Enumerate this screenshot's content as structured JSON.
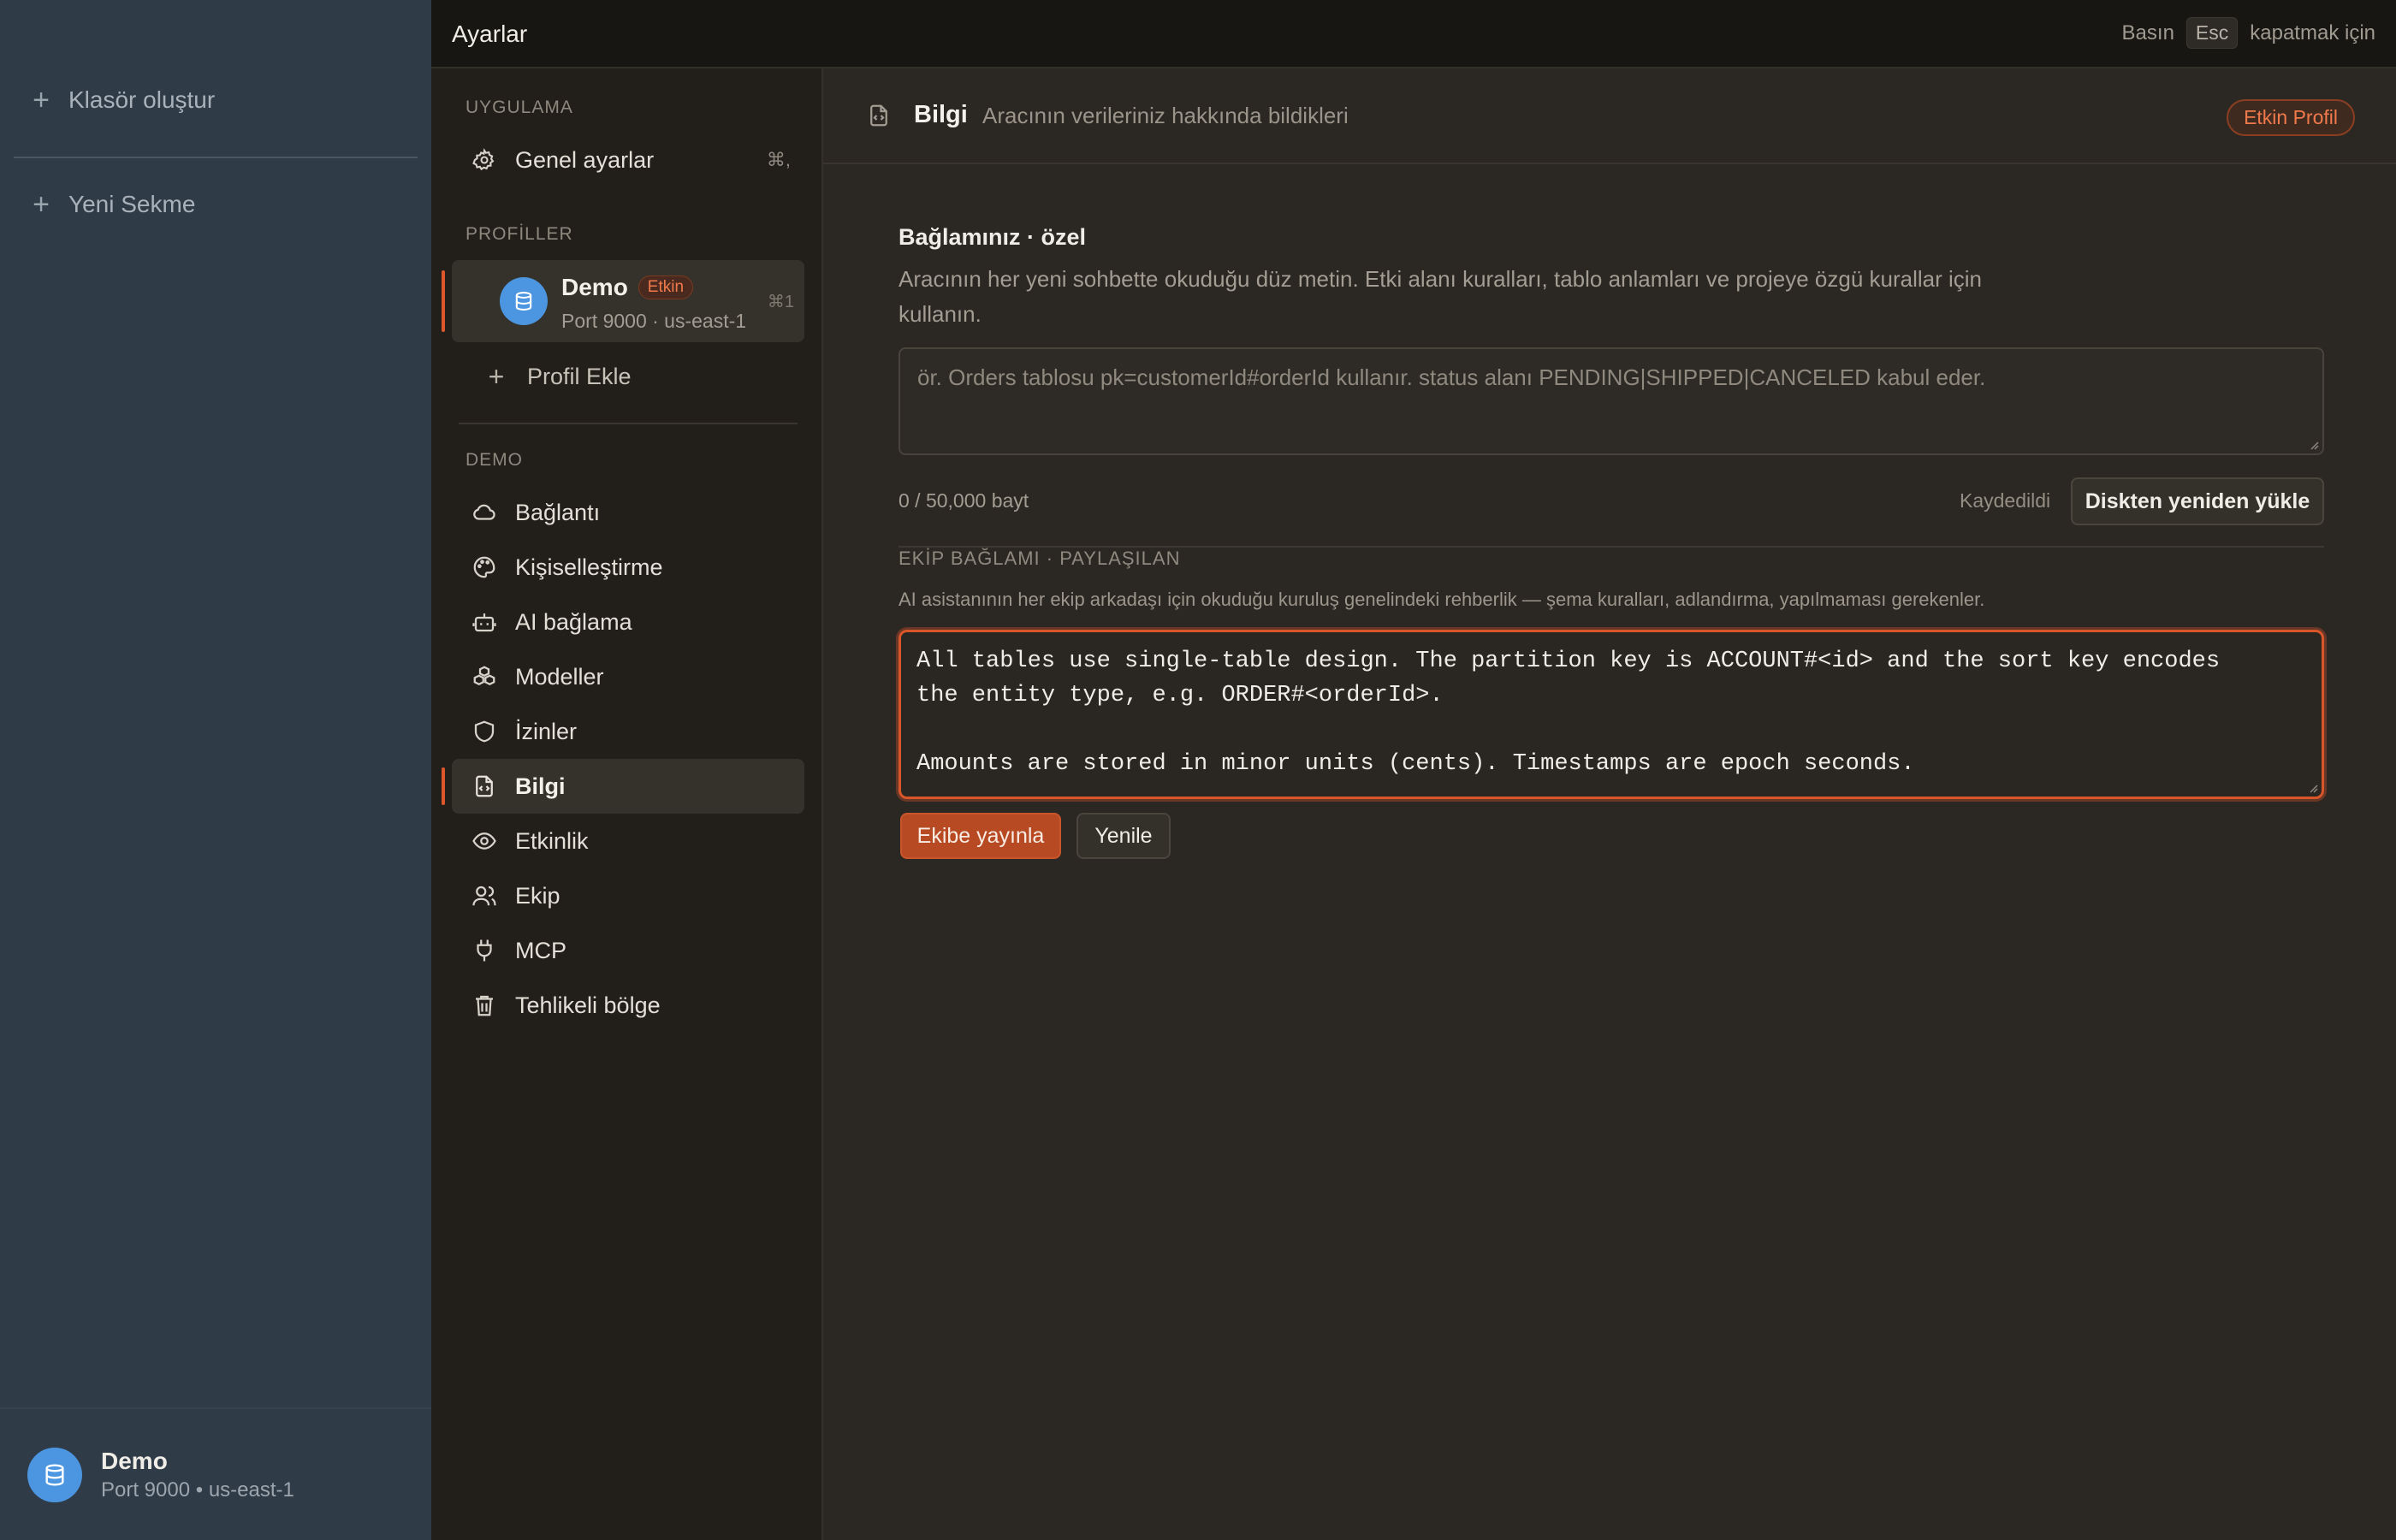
{
  "app_sidebar": {
    "create_folder": "Klasör oluştur",
    "new_tab": "Yeni Sekme",
    "profile": {
      "name": "Demo",
      "subtitle": "Port 9000 • us-east-1"
    }
  },
  "topbar": {
    "title": "Ayarlar",
    "hint_prefix": "Basın",
    "hint_key": "Esc",
    "hint_suffix": "kapatmak için"
  },
  "nav": {
    "section_app": "UYGULAMA",
    "general": {
      "label": "Genel ayarlar",
      "shortcut": "⌘,"
    },
    "section_profiles": "PROFİLLER",
    "profile": {
      "name": "Demo",
      "badge": "Etkin",
      "subtitle": "Port 9000 · us-east-1",
      "shortcut": "⌘1"
    },
    "add_profile": "Profil Ekle",
    "section_demo": "DEMO",
    "items": [
      {
        "label": "Bağlantı",
        "icon": "cloud-icon"
      },
      {
        "label": "Kişiselleştirme",
        "icon": "palette-icon"
      },
      {
        "label": "AI bağlama",
        "icon": "robot-icon"
      },
      {
        "label": "Modeller",
        "icon": "cubes-icon"
      },
      {
        "label": "İzinler",
        "icon": "shield-icon"
      },
      {
        "label": "Bilgi",
        "icon": "file-code-icon"
      },
      {
        "label": "Etkinlik",
        "icon": "eye-icon"
      },
      {
        "label": "Ekip",
        "icon": "users-icon"
      },
      {
        "label": "MCP",
        "icon": "plug-icon"
      },
      {
        "label": "Tehlikeli bölge",
        "icon": "trash-icon"
      }
    ],
    "active_item": "Bilgi"
  },
  "main": {
    "title": "Bilgi",
    "subtitle": "Aracının verileriniz hakkında bildikleri",
    "badge": "Etkin Profil",
    "private": {
      "title": "Bağlamınız · özel",
      "description": "Aracının her yeni sohbette okuduğu düz metin. Etki alanı kuralları, tablo anlamları ve projeye özgü kurallar için kullanın.",
      "placeholder": "ör. Orders tablosu pk=customerId#orderId kullanır. status alanı PENDING|SHIPPED|CANCELED kabul eder.",
      "value": "",
      "counter": "0 / 50,000 bayt",
      "saved": "Kaydedildi",
      "reload_button": "Diskten yeniden yükle"
    },
    "team": {
      "title": "EKİP BAĞLAMI · PAYLAŞILAN",
      "description": "AI asistanının her ekip arkadaşı için okuduğu kuruluş genelindeki rehberlik — şema kuralları, adlandırma, yapılmaması gerekenler.",
      "value": "All tables use single-table design. The partition key is ACCOUNT#<id> and the sort key encodes\nthe entity type, e.g. ORDER#<orderId>.\n\nAmounts are stored in minor units (cents). Timestamps are epoch seconds.",
      "publish_button": "Ekibe yayınla",
      "refresh_button": "Yenile"
    }
  },
  "colors": {
    "accent": "#e0562b",
    "sidebar_bg": "#2f3b47",
    "avatar": "#4c95e0"
  }
}
